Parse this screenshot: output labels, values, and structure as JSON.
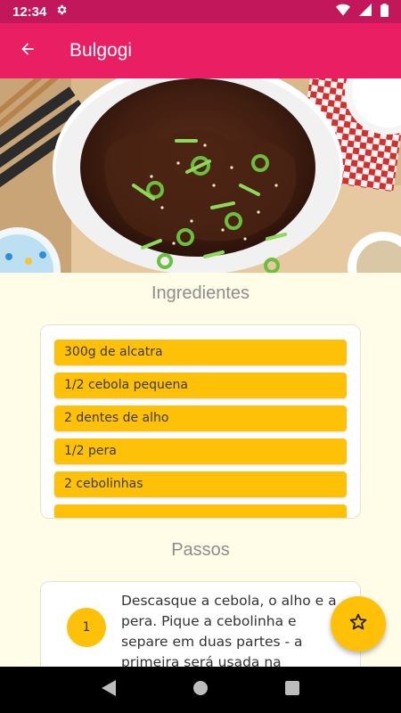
{
  "status": {
    "time": "12:34"
  },
  "app_bar": {
    "title": "Bulgogi"
  },
  "ingredients": {
    "title": "Ingredientes",
    "items": [
      "300g de alcatra",
      "1/2 cebola pequena",
      "2 dentes de alho",
      "1/2 pera",
      "2 cebolinhas",
      ""
    ]
  },
  "steps": {
    "title": "Passos",
    "items": [
      {
        "number": "1",
        "text": "Descasque a cebola, o alho e a pera. Pique a cebolinha e separe em duas partes - a primeira será usada na"
      }
    ]
  },
  "colors": {
    "primary": "#e91e63",
    "primary_dark": "#c2185b",
    "accent": "#ffc107",
    "background": "#fffde7"
  },
  "icons": {
    "back": "arrow-back-icon",
    "settings": "gear-icon",
    "fab": "star-outline-icon"
  }
}
